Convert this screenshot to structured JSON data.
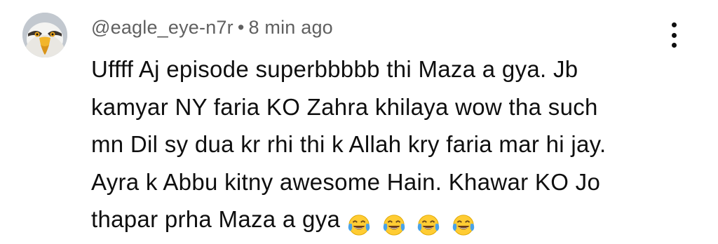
{
  "comment": {
    "author": "@eagle_eye-n7r",
    "separator": "•",
    "timestamp": "8 min ago",
    "lines": [
      "Uffff Aj episode superbbbbb thi Maza a gya. Jb",
      "kamyar NY faria KO Zahra khilaya wow tha such",
      "mn Dil sy dua kr rhi thi k Allah kry faria mar hi jay.",
      "Ayra k Abbu kitny awesome Hain. Khawar KO Jo",
      "thapar prha Maza a gya"
    ],
    "trailing_emojis": [
      "face-with-tears-of-joy",
      "face-with-tears-of-joy",
      "face-with-tears-of-joy",
      "face-with-tears-of-joy"
    ],
    "avatar_icon": "eagle-avatar-icon",
    "menu_icon": "more-vertical-icon"
  },
  "colors": {
    "meta_text": "#606060",
    "body_text": "#0f0f0f",
    "background": "#ffffff",
    "emoji_face": "#ffcc33",
    "emoji_tears": "#4aa3e8"
  }
}
